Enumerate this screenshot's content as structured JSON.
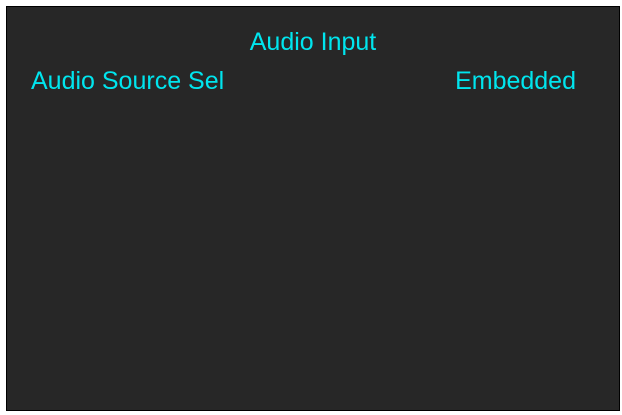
{
  "menu": {
    "title": "Audio Input",
    "items": [
      {
        "label": "Audio Source Sel",
        "value": "Embedded"
      }
    ]
  },
  "colors": {
    "background": "#272727",
    "text": "#00e5ee",
    "frame": "#ffffff"
  }
}
